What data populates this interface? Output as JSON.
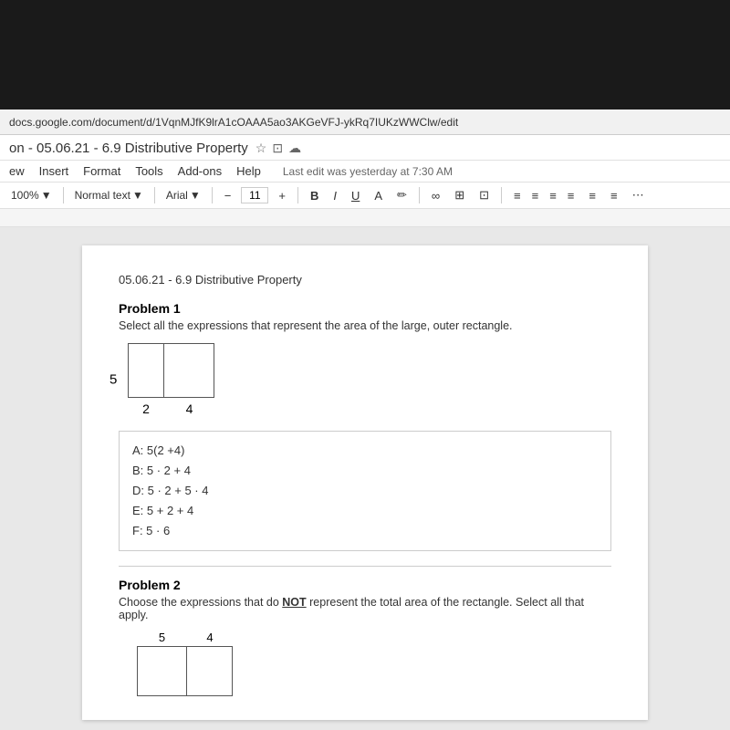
{
  "browser": {
    "url": "docs.google.com/document/d/1VqnMJfK9lrA1cOAAA5ao3AKGeVFJ-ykRq7IUKzWWClw/edit",
    "tab_title": "on - 05.06.21 - 6.9 Distributive Property",
    "tab_icons": [
      "star",
      "copy",
      "cloud"
    ]
  },
  "menu": {
    "items": [
      "ew",
      "Insert",
      "Format",
      "Tools",
      "Add-ons",
      "Help"
    ],
    "last_edit": "Last edit was yesterday at 7:30 AM"
  },
  "toolbar": {
    "zoom": "100%",
    "style": "Normal text",
    "font": "Arial",
    "font_size": "11",
    "bold": "B",
    "italic": "I",
    "underline": "U",
    "strikethrough": "A",
    "link": "∞",
    "image": "⊞",
    "comment": "⊡",
    "align_left": "≡",
    "align_center": "≡",
    "align_right": "≡",
    "align_justify": "≡",
    "line_spacing": "≡",
    "list_options": "≡",
    "more": "⋯"
  },
  "document": {
    "doc_title": "05.06.21 - 6.9 Distributive Property",
    "problem1": {
      "title": "Problem 1",
      "description": "Select all the expressions that represent the area of the large, outer rectangle.",
      "diagram": {
        "side_label": "5",
        "bottom_labels": [
          "2",
          "4"
        ]
      },
      "answers": [
        "A:  5(2 +4)",
        "B:  5 · 2 + 4",
        "D:  5 · 2 + 5 · 4",
        "E:  5 + 2 + 4",
        "F:  5 · 6"
      ]
    },
    "problem2": {
      "title": "Problem 2",
      "description_before": "Choose the expressions that do ",
      "description_bold": "NOT",
      "description_after": " represent the total area of the rectangle. Select all that apply.",
      "diagram": {
        "top_labels": [
          "5",
          "4"
        ]
      }
    }
  },
  "normal_text_detection": "Normal"
}
